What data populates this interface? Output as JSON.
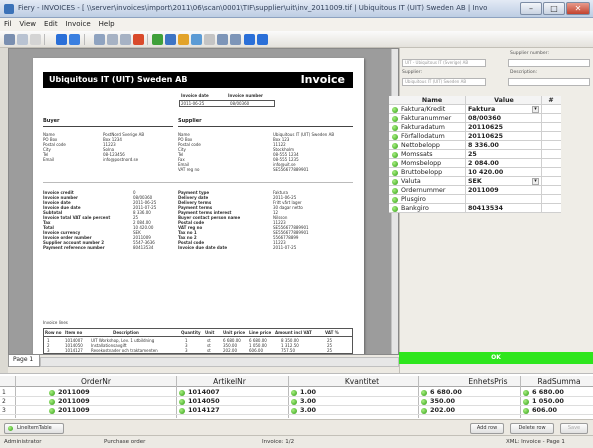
{
  "window": {
    "title": "Fiery - INVOICES - [ \\\\server\\invoices\\import\\2011\\06\\scan\\0001\\TIF\\supplier\\uit\\inv_2011009.tif | Ubiquitous IT (UIT) Sweden AB | Invoice ]",
    "min": "–",
    "max": "□",
    "close": "✕"
  },
  "menu": [
    "Fil",
    "View",
    "Edit",
    "Invoice",
    "Help"
  ],
  "invoice": {
    "company": "Ubiquitous IT (UIT) Sweden AB",
    "doc_type": "Invoice",
    "date_label": "Invoice date",
    "number_label": "Invoice number",
    "date_value": "2011-06-25",
    "number_value": "08/00360",
    "buyer_label": "Buyer",
    "supplier_label": "Supplier",
    "buyer_lines": [
      "Name",
      "PO Box",
      "Postal code",
      "City",
      "Tel",
      "Email"
    ],
    "buyer_values": [
      "PostNord Sverige AB",
      "Box 1234",
      "11223",
      "Solna",
      "08-123456",
      "info@postnord.se"
    ],
    "supplier_lines": [
      "Name",
      "PO Box",
      "Postal code",
      "City",
      "Tel",
      "Fax",
      "Email",
      "VAT reg no"
    ],
    "supplier_values": [
      "Ubiquitous IT (UIT) Sweden AB",
      "Box 123",
      "11122",
      "Stockholm",
      "08-555 1234",
      "08-555 1235",
      "info@uit.se",
      "SE556677889901"
    ],
    "details_left_labels": [
      "Invoice credit",
      "Invoice number",
      "Invoice date",
      "Invoice due date",
      "Subtotal",
      "Invoice total VAT sale percent",
      "Tax",
      "Total",
      "Invoice currency",
      "Invoice order number",
      "Supplier account number 2",
      "Payment reference number"
    ],
    "details_left_values": [
      "0",
      "08/00360",
      "2011-06-25",
      "2011-07-25",
      "8 336.00",
      "25",
      "2 084.00",
      "10 420.00",
      "SEK",
      "2011009",
      "5547-3636",
      "80413534"
    ],
    "details_right_labels": [
      "Payment type",
      "Delivery date",
      "Delivery terms",
      "Payment terms",
      "Payment terms interest",
      "Buyer contact person name",
      "Postal code",
      "VAT reg no",
      "Tax no 1",
      "Tax no 2",
      "Postal code",
      "Invoice due date date"
    ],
    "details_right_values": [
      "Faktura",
      "2011-06-25",
      "Fritt vårt lager",
      "30 dagar netto",
      "12",
      "Nilsson",
      "11223",
      "SE556677889901",
      "SE556677889901",
      "5566778899",
      "11223",
      "2011-07-25"
    ],
    "line_table_caption": "Invoice lines",
    "line_table_headers": [
      "Row no",
      "Item no",
      "Description",
      "Quantity",
      "Unit",
      "Unit price",
      "Line price",
      "Amount incl VAT",
      "VAT %"
    ],
    "line_table_rows": [
      [
        "1",
        "1014007",
        "UIT Workshop, Lev. 1 utbildning",
        "1",
        "st",
        "6 680.00",
        "6 680.00",
        "8 350.00",
        "25"
      ],
      [
        "2",
        "1014050",
        "Installationsavgift",
        "3",
        "st",
        "350.00",
        "1 050.00",
        "1 312.50",
        "25"
      ],
      [
        "3",
        "1014127",
        "Resekostnader och traktamenten",
        "3",
        "st",
        "202.00",
        "606.00",
        "757.50",
        "25"
      ]
    ]
  },
  "viewer": {
    "page_tab": "Page 1"
  },
  "right_panel": {
    "supplier_number_label": "Supplier number:",
    "description_label": "Description:",
    "supplier_label": "Supplier:",
    "top_field": "UIT - Ubiquitous IT (Sverige) AB",
    "supplier_field": "Ubiquitous IT (UIT) Sweden AB",
    "col_name": "Name",
    "col_value": "Value",
    "col_hash": "#",
    "rows": [
      {
        "name": "Faktura/Kredit",
        "value": "Faktura",
        "dropdown": true
      },
      {
        "name": "Fakturanummer",
        "value": "08/00360"
      },
      {
        "name": "Fakturadatum",
        "value": "20110625"
      },
      {
        "name": "Förfallodatum",
        "value": "20110625"
      },
      {
        "name": "Nettobelopp",
        "value": "8 336.00"
      },
      {
        "name": "Momssats",
        "value": "25"
      },
      {
        "name": "Momsbelopp",
        "value": "2 084.00"
      },
      {
        "name": "Bruttobelopp",
        "value": "10 420.00"
      },
      {
        "name": "Valuta",
        "value": "SEK",
        "dropdown": true
      },
      {
        "name": "Ordernummer",
        "value": "2011009"
      },
      {
        "name": "Plusgiro",
        "value": ""
      },
      {
        "name": "Bankgiro",
        "value": "80413534"
      }
    ],
    "status": "OK",
    "status_color": "#2ee61d"
  },
  "lines_grid": {
    "headers": [
      "OrderNr",
      "ArtikelNr",
      "Kvantitet",
      "EnhetsPris",
      "RadSumma"
    ],
    "rows": [
      {
        "n": "1",
        "order": "2011009",
        "article": "1014007",
        "qty": "1.00",
        "price": "6 680.00",
        "sum": "6 680.00"
      },
      {
        "n": "2",
        "order": "2011009",
        "article": "1014050",
        "qty": "3.00",
        "price": "350.00",
        "sum": "1 050.00"
      },
      {
        "n": "3",
        "order": "2011009",
        "article": "1014127",
        "qty": "3.00",
        "price": "202.00",
        "sum": "606.00"
      }
    ]
  },
  "actions": {
    "left_button": "LineItemTable",
    "add": "Add row",
    "delete": "Delete row",
    "save": "Save"
  },
  "statusbar": {
    "user": "Administrator",
    "purchase_order": "Purchase order",
    "invoice": "Invoice: 1/2",
    "xml": "XML: Invoice - Page 1"
  }
}
